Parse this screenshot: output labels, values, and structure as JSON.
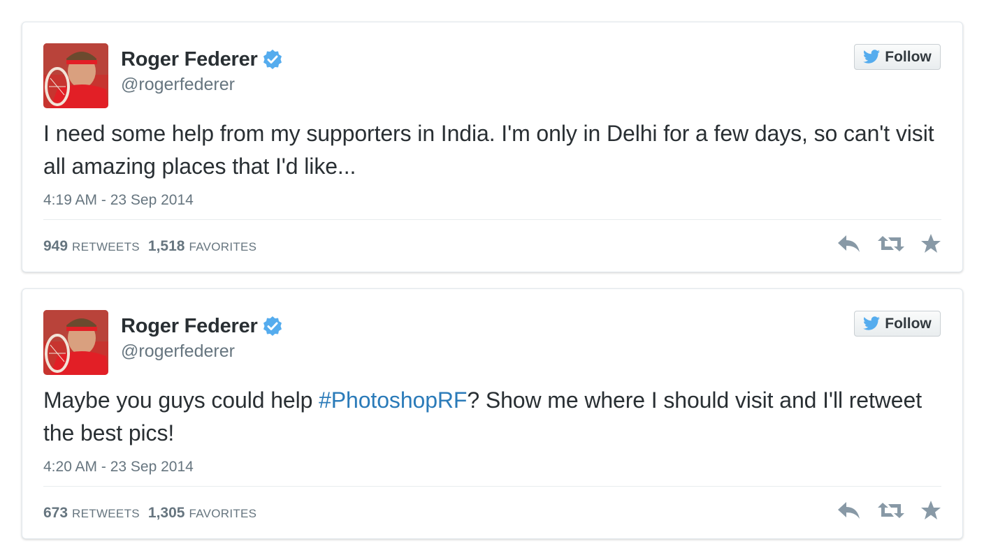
{
  "colors": {
    "text": "#292f33",
    "muted": "#66757f",
    "link": "#2b7bb9",
    "verified": "#55acee",
    "action_icon": "#8899a6",
    "avatar_red": "#d6222b"
  },
  "tweets": [
    {
      "author": {
        "name": "Roger Federer",
        "handle": "@rogerfederer",
        "verified_icon": "verified-badge-icon"
      },
      "follow_label": "Follow",
      "text": "I need some help from my supporters in India. I'm only in Delhi for a few days, so can't visit all amazing places that I'd like...",
      "timestamp": "4:19 AM - 23 Sep 2014",
      "retweets": "949",
      "retweets_label": "RETWEETS",
      "favorites": "1,518",
      "favorites_label": "FAVORITES"
    },
    {
      "author": {
        "name": "Roger Federer",
        "handle": "@rogerfederer",
        "verified_icon": "verified-badge-icon"
      },
      "follow_label": "Follow",
      "text_before": "Maybe you guys could help ",
      "hashtag": "#PhotoshopRF",
      "text_after": "? Show me where I should visit and I'll retweet the best pics!",
      "timestamp": "4:20 AM - 23 Sep 2014",
      "retweets": "673",
      "retweets_label": "RETWEETS",
      "favorites": "1,305",
      "favorites_label": "FAVORITES"
    }
  ],
  "action_icons": [
    "reply-icon",
    "retweet-icon",
    "favorite-star-icon"
  ]
}
